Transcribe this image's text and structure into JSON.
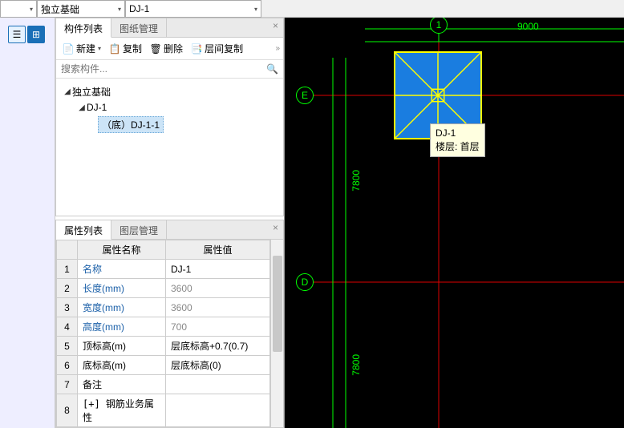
{
  "dropdowns": {
    "d1": "",
    "d2": "独立基础",
    "d3": "DJ-1"
  },
  "component_panel": {
    "tabs": [
      "构件列表",
      "图纸管理"
    ],
    "active_tab": 0,
    "toolbar": {
      "new": "新建",
      "copy": "复制",
      "delete": "删除",
      "layer_copy": "层间复制"
    },
    "search_placeholder": "搜索构件...",
    "tree": {
      "root": "独立基础",
      "child": "DJ-1",
      "leaf": "（底）DJ-1-1"
    }
  },
  "property_panel": {
    "tabs": [
      "属性列表",
      "图层管理"
    ],
    "active_tab": 0,
    "headers": {
      "name": "属性名称",
      "value": "属性值"
    },
    "rows": [
      {
        "n": "1",
        "name": "名称",
        "value": "DJ-1",
        "link": true
      },
      {
        "n": "2",
        "name": "长度(mm)",
        "value": "3600",
        "link": true,
        "dim": true
      },
      {
        "n": "3",
        "name": "宽度(mm)",
        "value": "3600",
        "link": true,
        "dim": true
      },
      {
        "n": "4",
        "name": "高度(mm)",
        "value": "700",
        "link": true,
        "dim": true
      },
      {
        "n": "5",
        "name": "顶标高(m)",
        "value": "层底标高+0.7(0.7)",
        "link": false
      },
      {
        "n": "6",
        "name": "底标高(m)",
        "value": "层底标高(0)",
        "link": false
      },
      {
        "n": "7",
        "name": "备注",
        "value": "",
        "link": false
      },
      {
        "n": "8",
        "name": "钢筋业务属性",
        "value": "",
        "link": false,
        "expand": true
      }
    ]
  },
  "canvas": {
    "grid_1": "1",
    "grid_E": "E",
    "grid_D": "D",
    "dim_9000": "9000",
    "dim_7800a": "7800",
    "dim_7800b": "7800",
    "tooltip_l1": "DJ-1",
    "tooltip_l2": "楼层: 首层"
  }
}
